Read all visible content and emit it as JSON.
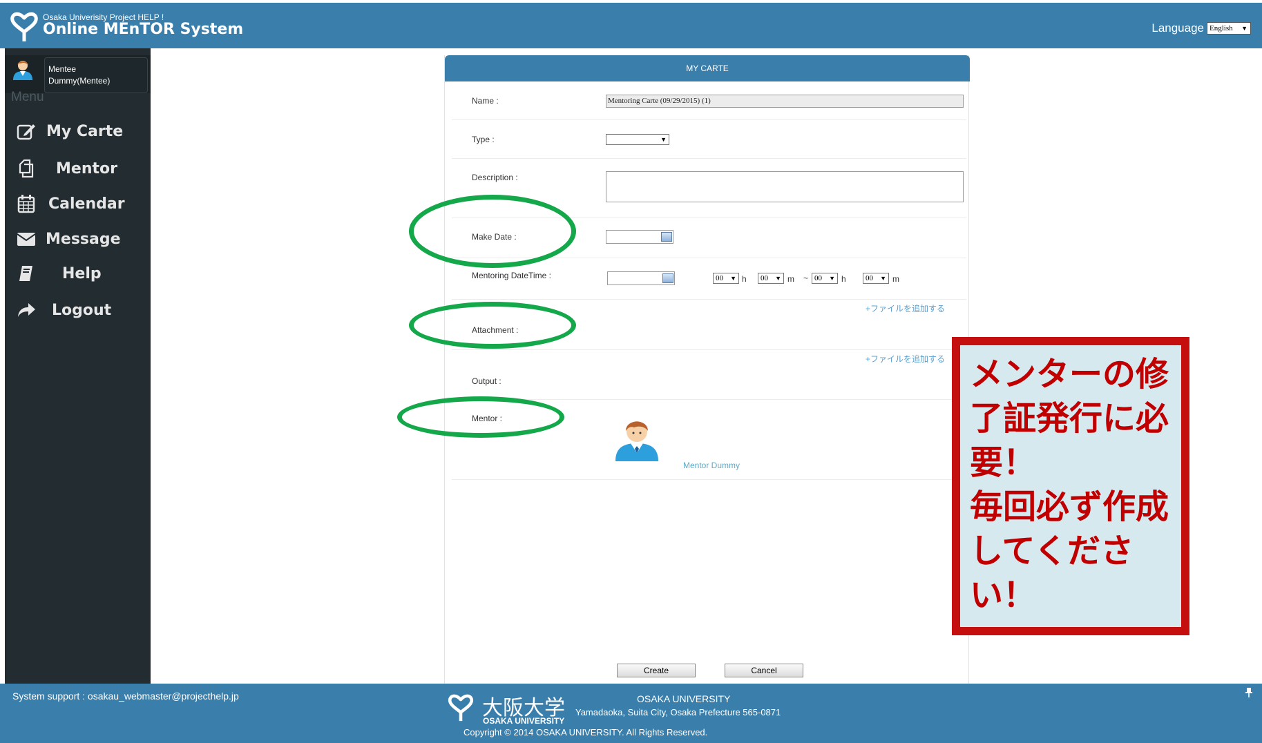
{
  "header": {
    "subtitle": "Osaka Univerisity Project HELP !",
    "title": "Online MEnTOR System",
    "language_label": "Language",
    "language_value": "English"
  },
  "user": {
    "role": "Mentee",
    "name": "Dummy(Mentee)"
  },
  "sidebar": {
    "menu_heading": "Menu",
    "items": [
      {
        "label": "My Carte",
        "icon": "edit-icon"
      },
      {
        "label": "Mentor",
        "icon": "copy-icon"
      },
      {
        "label": "Calendar",
        "icon": "calendar-icon"
      },
      {
        "label": "Message",
        "icon": "envelope-icon"
      },
      {
        "label": "Help",
        "icon": "book-icon"
      },
      {
        "label": "Logout",
        "icon": "share-arrow-icon"
      }
    ]
  },
  "form": {
    "title": "MY CARTE",
    "name_label": "Name :",
    "name_value": "Mentoring Carte (09/29/2015) (1)",
    "type_label": "Type :",
    "type_value": "",
    "description_label": "Description :",
    "make_date_label": "Make Date :",
    "mentoring_datetime_label": "Mentoring DateTime :",
    "start_hour": "00",
    "start_minute": "00",
    "end_hour": "00",
    "end_minute": "00",
    "hour_unit": "h",
    "minute_unit": "m",
    "range_sep": "~",
    "add_file_label": "+ファイルを追加する",
    "attachment_label": "Attachment :",
    "output_label": "Output :",
    "mentor_label": "Mentor :",
    "mentor_name": "Mentor Dummy",
    "create_label": "Create",
    "cancel_label": "Cancel"
  },
  "callout": {
    "text": "メンターの修了証発行に必要！\n毎回必ず作成してください！"
  },
  "footer": {
    "support": "System support : osakau_webmaster@projecthelp.jp",
    "univ_ja": "大阪大学",
    "univ_en_small": "OSAKA UNIVERSITY",
    "univ_name": "OSAKA UNIVERSITY",
    "address": "Yamadaoka, Suita City, Osaka Prefecture 565-0871",
    "copyright": "Copyright © 2014 OSAKA UNIVERSITY. All Rights Reserved."
  },
  "colors": {
    "header_blue": "#3a7fac",
    "sidebar_dark": "#222c31",
    "ellipse_green": "#14a84a",
    "callout_red": "#c50f0f",
    "callout_bg": "#d6e9ef"
  }
}
